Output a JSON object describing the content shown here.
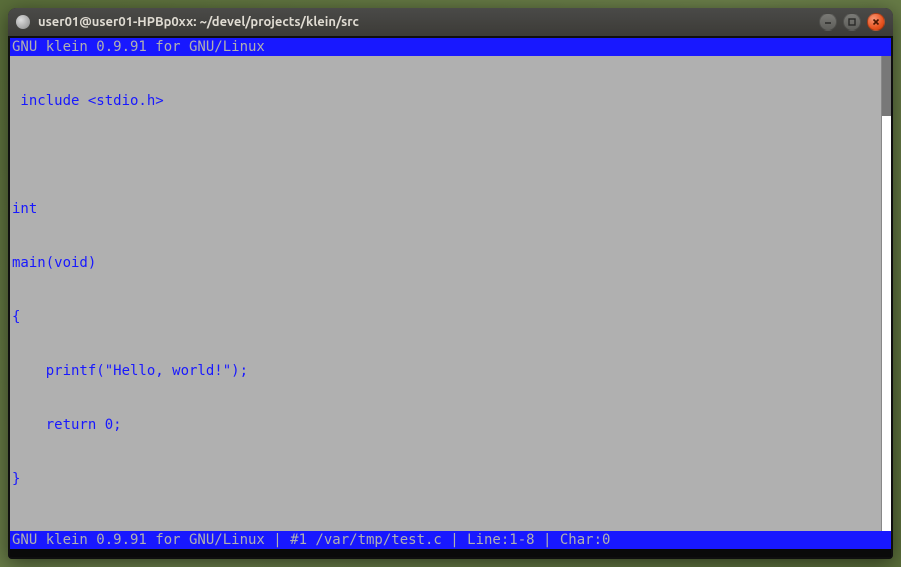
{
  "window": {
    "title": "user01@user01-HPBp0xx: ~/devel/projects/klein/src"
  },
  "editor": {
    "header": "GNU klein 0.9.91 for GNU/Linux",
    "status": "GNU klein 0.9.91 for GNU/Linux | #1 /var/tmp/test.c | Line:1-8 | Char:0",
    "lines": {
      "l0": " include <stdio.h>",
      "l1": "",
      "l2": "int",
      "l3": "main(void)",
      "l4": "{",
      "l5": "    printf(\"Hello, world!\");",
      "l6": "    return 0;",
      "l7": "}"
    }
  },
  "colors": {
    "bar_bg": "#1818ff",
    "editor_bg": "#b0b0b0",
    "editor_fg": "#1818ff"
  }
}
